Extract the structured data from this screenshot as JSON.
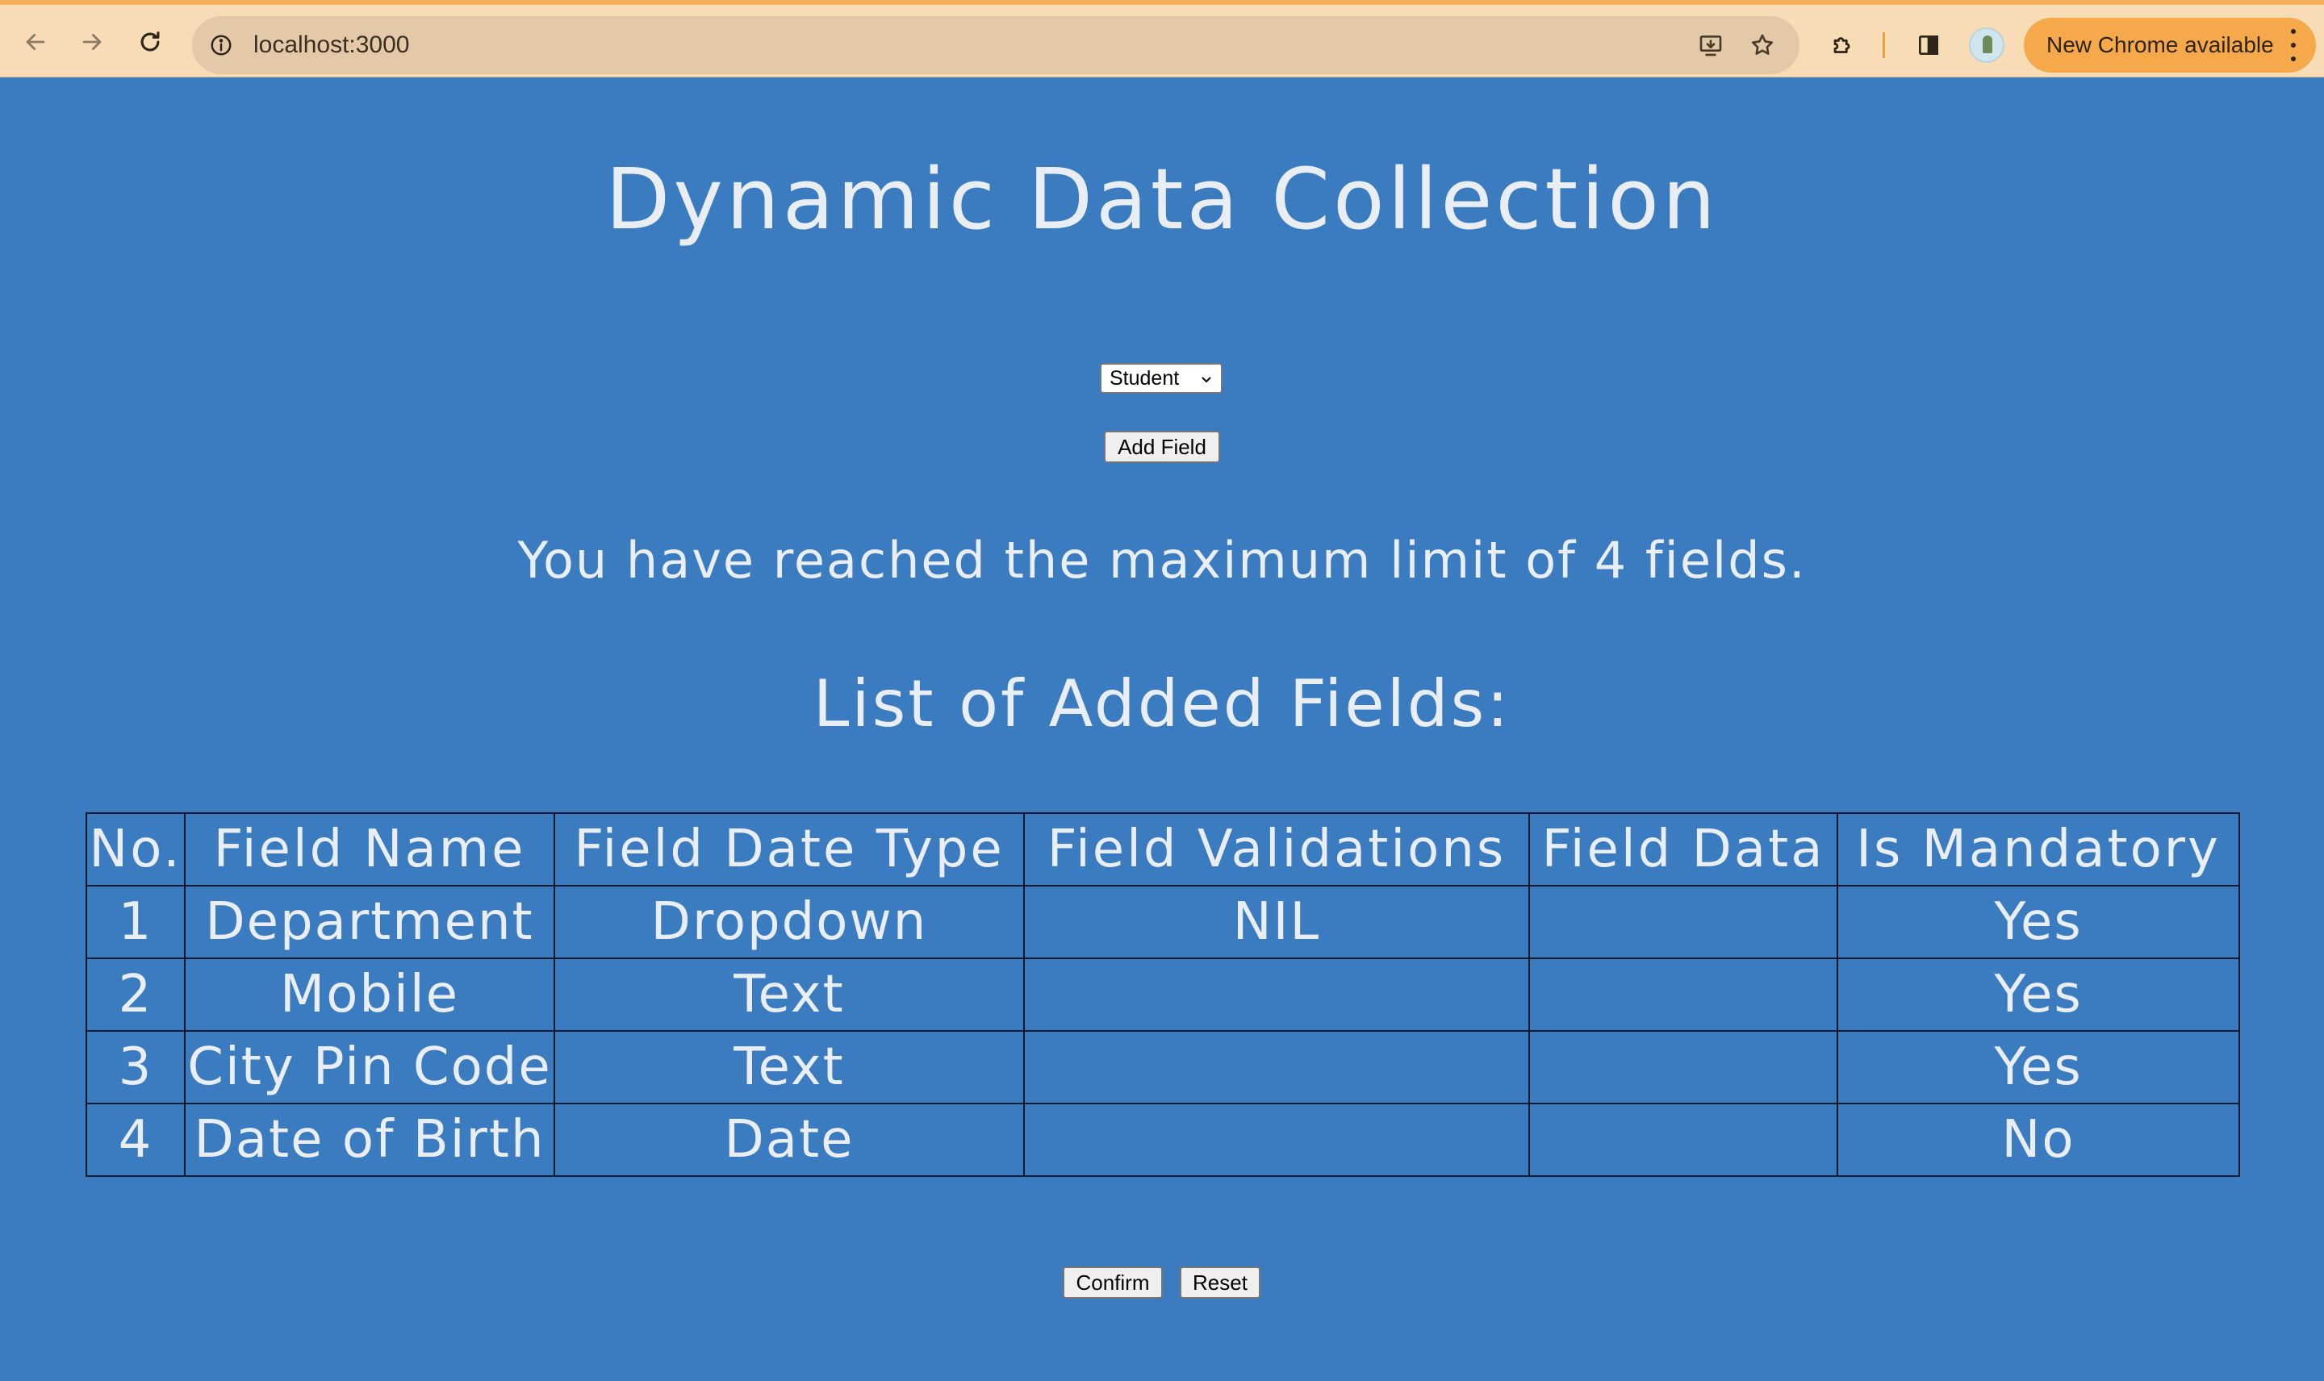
{
  "browser": {
    "url": "localhost:3000",
    "update_label": "New Chrome available"
  },
  "page": {
    "title": "Dynamic Data Collection",
    "select": {
      "value": "Student"
    },
    "add_field_label": "Add Field",
    "limit_message": "You have reached the maximum limit of 4 fields.",
    "list_heading": "List of Added Fields:",
    "table": {
      "headers": [
        "No.",
        "Field Name",
        "Field Date Type",
        "Field Validations",
        "Field Data",
        "Is Mandatory"
      ],
      "rows": [
        [
          "1",
          "Department",
          "Dropdown",
          "NIL",
          "",
          "Yes"
        ],
        [
          "2",
          "Mobile",
          "Text",
          "",
          "",
          "Yes"
        ],
        [
          "3",
          "City Pin Code",
          "Text",
          "",
          "",
          "Yes"
        ],
        [
          "4",
          "Date of Birth",
          "Date",
          "",
          "",
          "No"
        ]
      ]
    },
    "confirm_label": "Confirm",
    "reset_label": "Reset"
  },
  "colors": {
    "page_background": "#3b7bc0",
    "text": "#e9eef5",
    "chrome_background": "#f7dcb6",
    "update_pill": "#f5a94a"
  }
}
